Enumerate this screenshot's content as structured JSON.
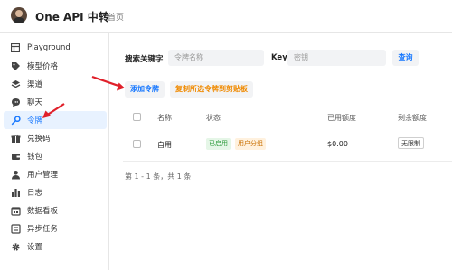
{
  "app": {
    "title": "One API 中转",
    "home": "首页"
  },
  "sidebar": {
    "items": [
      {
        "label": "Playground",
        "icon": "layout-icon"
      },
      {
        "label": "模型价格",
        "icon": "tag-icon"
      },
      {
        "label": "渠道",
        "icon": "layers-icon"
      },
      {
        "label": "聊天",
        "icon": "chat-icon"
      },
      {
        "label": "令牌",
        "icon": "key-icon",
        "active": true
      },
      {
        "label": "兑换码",
        "icon": "gift-icon"
      },
      {
        "label": "钱包",
        "icon": "wallet-icon"
      },
      {
        "label": "用户管理",
        "icon": "user-icon"
      },
      {
        "label": "日志",
        "icon": "bar-chart-icon"
      },
      {
        "label": "数据看板",
        "icon": "calendar-icon"
      },
      {
        "label": "异步任务",
        "icon": "list-icon"
      },
      {
        "label": "设置",
        "icon": "gear-icon"
      }
    ]
  },
  "search": {
    "label": "搜索关键字",
    "placeholder": "令牌名称",
    "key_label": "Key",
    "key_placeholder": "密钥",
    "query_button": "查询"
  },
  "actions": {
    "add_button": "添加令牌",
    "copy_button": "复制所选令牌到剪贴板"
  },
  "table": {
    "headers": [
      "名称",
      "状态",
      "已用额度",
      "剩余额度"
    ],
    "rows": [
      {
        "name": "自用",
        "status": "已启用",
        "group": "用户分组",
        "used": "$0.00",
        "remaining": "无限制"
      }
    ]
  },
  "pagination": {
    "text": "第 1 - 1 条，共 1 条"
  },
  "colors": {
    "accent": "#1677ff",
    "active_bg": "#e8f2ff",
    "copy_button": "#f08a00",
    "arrow": "#e0202a"
  }
}
